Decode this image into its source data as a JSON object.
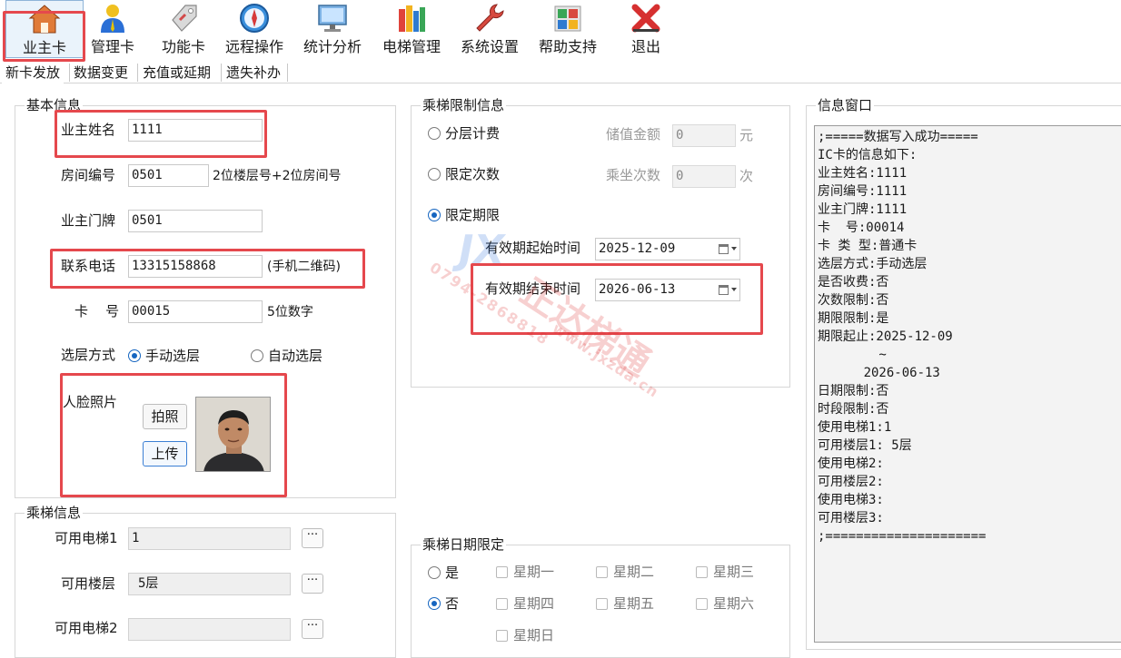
{
  "toolbar": {
    "items": [
      {
        "label": "业主卡",
        "icon": "house-icon"
      },
      {
        "label": "管理卡",
        "icon": "person-icon"
      },
      {
        "label": "功能卡",
        "icon": "tag-icon"
      },
      {
        "label": "远程操作",
        "icon": "compass-icon"
      },
      {
        "label": "统计分析",
        "icon": "monitor-icon"
      },
      {
        "label": "电梯管理",
        "icon": "books-icon"
      },
      {
        "label": "系统设置",
        "icon": "wrench-icon"
      },
      {
        "label": "帮助支持",
        "icon": "map-icon"
      },
      {
        "label": "退出",
        "icon": "exit-x-icon"
      }
    ]
  },
  "tabs": [
    "新卡发放",
    "数据变更",
    "充值或延期",
    "遗失补办"
  ],
  "basic": {
    "title": "基本信息",
    "owner_name_label": "业主姓名",
    "owner_name": "1111",
    "room_label": "房间编号",
    "room": "0501",
    "room_hint": "2位楼层号+2位房间号",
    "door_label": "业主门牌",
    "door": "0501",
    "phone_label": "联系电话",
    "phone": "13315158868",
    "phone_hint": "(手机二维码)",
    "card_label": "卡    号",
    "card": "00015",
    "card_hint": "5位数字",
    "floor_mode_label": "选层方式",
    "manual": "手动选层",
    "auto": "自动选层",
    "face_label": "人脸照片",
    "capture_btn": "拍照",
    "upload_btn": "上传"
  },
  "elevator": {
    "title": "乘梯信息",
    "elev1_label": "可用电梯1",
    "elev1": "1",
    "floor1_label": "可用楼层",
    "floor1": "5层",
    "elev2_label": "可用电梯2",
    "elev2": "",
    "more": "···"
  },
  "limit": {
    "title": "乘梯限制信息",
    "floor_fee": "分层计费",
    "stored_label": "储值金额",
    "stored_value": "0",
    "stored_unit": "元",
    "times": "限定次数",
    "rides_label": "乘坐次数",
    "rides_value": "0",
    "rides_unit": "次",
    "period": "限定期限",
    "start_label": "有效期起始时间",
    "start": "2025-12-09",
    "end_label": "有效期结束时间",
    "end": "2026-06-13"
  },
  "date_limit": {
    "title": "乘梯日期限定",
    "yes": "是",
    "no": "否",
    "days": [
      "星期一",
      "星期二",
      "星期三",
      "星期四",
      "星期五",
      "星期六",
      "星期日"
    ]
  },
  "info": {
    "title": "信息窗口",
    "text": ";=====数据写入成功=====\nIC卡的信息如下:\n业主姓名:1111\n房间编号:1111\n业主门牌:1111\n卡  号:00014\n卡 类 型:普通卡\n选层方式:手动选层\n是否收费:否\n次数限制:否\n期限限制:是\n期限起止:2025-12-09\n        ~\n      2026-06-13\n日期限制:否\n时段限制:否\n使用电梯1:1\n可用楼层1: 5层\n使用电梯2:\n可用楼层2:\n使用电梯3:\n可用楼层3:\n;====================="
  },
  "watermark": {
    "phone": "0794-2868818",
    "brand": "正达梯通",
    "site": "www.jxzda.cn"
  },
  "colors": {
    "highlight": "#e5484d",
    "radio_on": "#1565c0"
  }
}
